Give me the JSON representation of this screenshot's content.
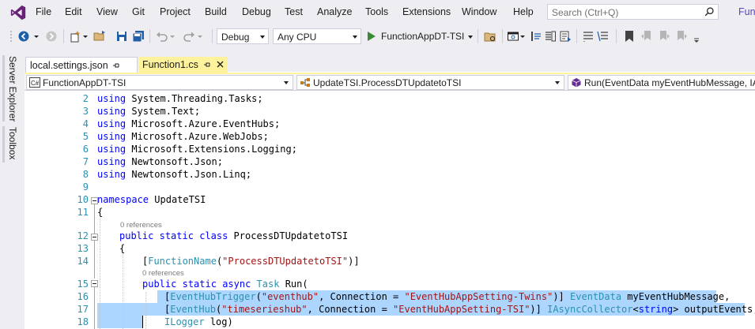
{
  "menu": {
    "items": [
      "File",
      "Edit",
      "View",
      "Git",
      "Project",
      "Build",
      "Debug",
      "Test",
      "Analyze",
      "Tools",
      "Extensions",
      "Window",
      "Help"
    ],
    "search_placeholder": "Search (Ctrl+Q)",
    "solution_name": "Func"
  },
  "toolbar": {
    "configuration": "Debug",
    "platform": "Any CPU",
    "startup_project": "FunctionAppDT-TSI"
  },
  "side_panels": [
    "Server Explorer",
    "Toolbox"
  ],
  "tabs": [
    {
      "label": "local.settings.json",
      "active": false
    },
    {
      "label": "Function1.cs",
      "active": true
    }
  ],
  "navigation": {
    "project": "FunctionAppDT-TSI",
    "type": "UpdateTSI.ProcessDTUpdatetoTSI",
    "member": "Run(EventData myEventHubMessage, IAs"
  },
  "editor": {
    "codelens": [
      "0 references",
      "0 references"
    ],
    "lines": [
      {
        "n": "2",
        "text": "using System.Threading.Tasks;"
      },
      {
        "n": "3",
        "text": "using System.Text;"
      },
      {
        "n": "4",
        "text": "using Microsoft.Azure.EventHubs;"
      },
      {
        "n": "5",
        "text": "using Microsoft.Azure.WebJobs;"
      },
      {
        "n": "6",
        "text": "using Microsoft.Extensions.Logging;"
      },
      {
        "n": "7",
        "text": "using Newtonsoft.Json;"
      },
      {
        "n": "8",
        "text": "using Newtonsoft.Json.Linq;"
      },
      {
        "n": "9",
        "text": ""
      },
      {
        "n": "10",
        "text": "namespace UpdateTSI"
      },
      {
        "n": "11",
        "text": "{"
      },
      {
        "n": "12",
        "text": "public static class ProcessDTUpdatetoTSI"
      },
      {
        "n": "13",
        "text": "{"
      },
      {
        "n": "14",
        "text": "[FunctionName(\"ProcessDTUpdatetoTSI\")]"
      },
      {
        "n": "15",
        "text": "public static async Task Run("
      },
      {
        "n": "16",
        "text": "[EventHubTrigger(\"eventhub\", Connection = \"EventHubAppSetting-Twins\")] EventData myEventHubMessage,"
      },
      {
        "n": "17",
        "text": "[EventHub(\"timeserieshub\", Connection = \"EventHubAppSetting-TSI\")] IAsyncCollector<string> outputEvents,"
      },
      {
        "n": "18",
        "text": "ILogger log)"
      }
    ]
  },
  "colors": {
    "chrome": "#eeeef2",
    "accent": "#68217a",
    "active_tab": "#fff29d",
    "keyword": "#0000ff",
    "type": "#2b91af",
    "string": "#a31515",
    "selection": "#add6ff"
  }
}
